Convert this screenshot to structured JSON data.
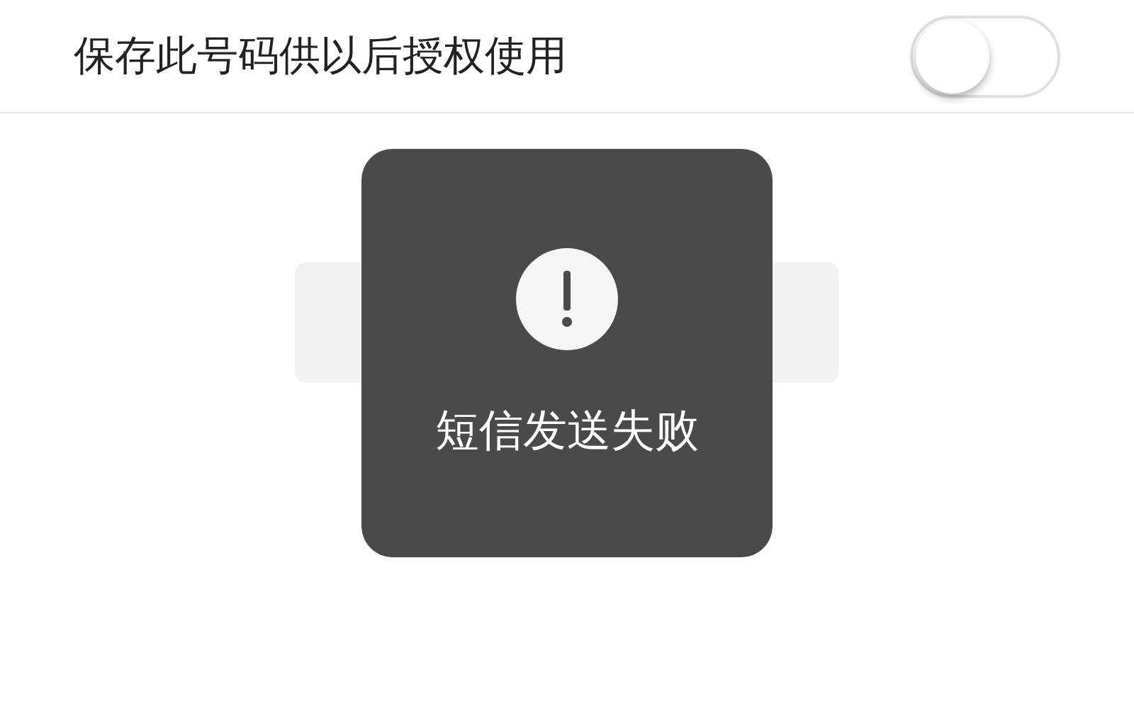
{
  "setting": {
    "label": "保存此号码供以后授权使用",
    "on": false
  },
  "toast": {
    "message": "短信发送失败"
  }
}
